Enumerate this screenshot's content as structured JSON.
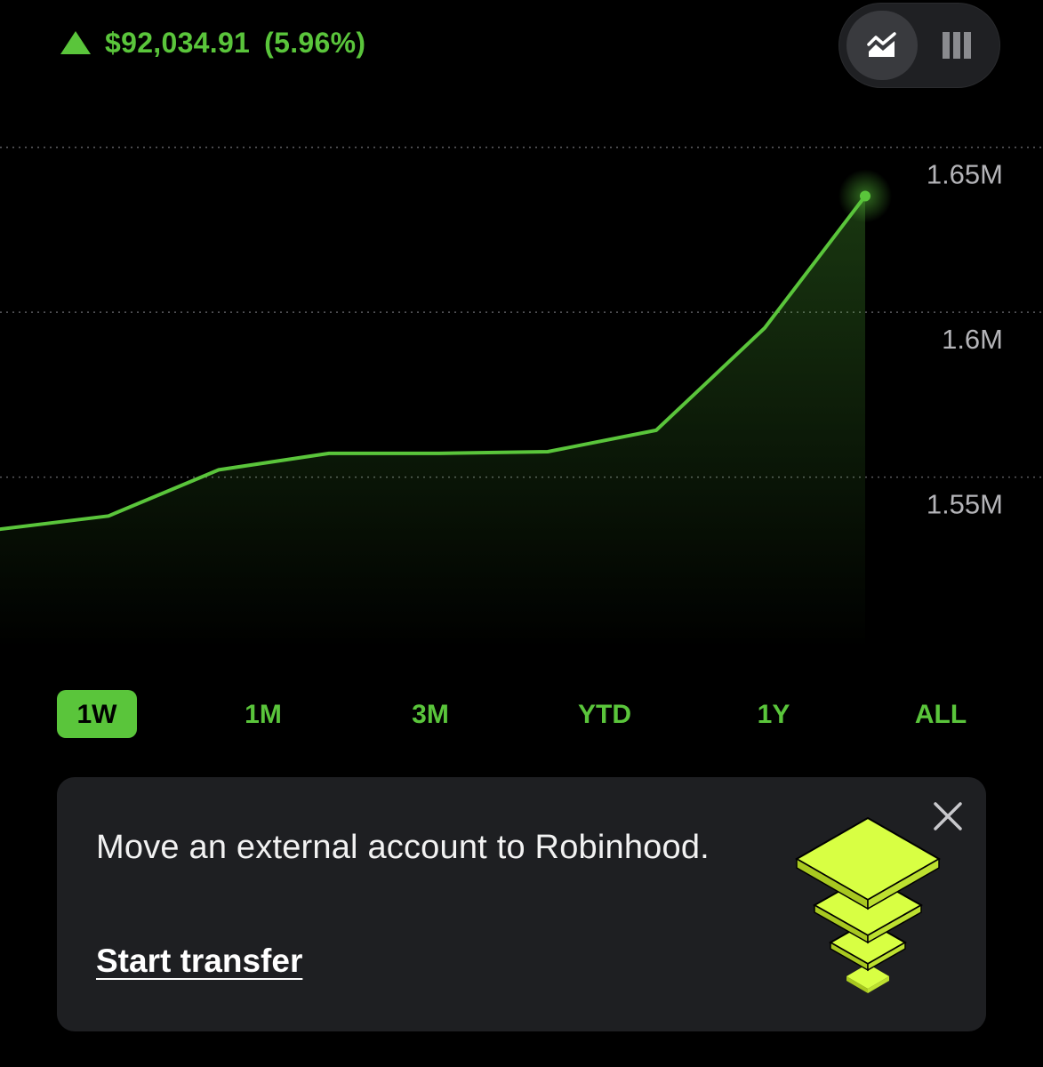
{
  "header": {
    "change_amount": "$92,034.91",
    "change_percent": "(5.96%)",
    "direction": "up",
    "accent_color": "#5ac53b"
  },
  "chart_toggle": {
    "options": [
      {
        "icon": "line-chart-icon",
        "selected": true
      },
      {
        "icon": "bar-chart-icon",
        "selected": false
      }
    ]
  },
  "chart_data": {
    "type": "area",
    "y_tick_labels": [
      "1.65M",
      "1.6M",
      "1.55M"
    ],
    "y_ticks": [
      1650000,
      1600000,
      1550000
    ],
    "ylim": [
      1510000,
      1665000
    ],
    "grid": true,
    "values": [
      1545000,
      1549000,
      1563000,
      1568000,
      1568000,
      1568500,
      1575000,
      1606000,
      1646000
    ],
    "line_color": "#5ac53b",
    "current_point_marker": true
  },
  "ranges": {
    "items": [
      "1W",
      "1M",
      "3M",
      "YTD",
      "1Y",
      "ALL"
    ],
    "selected": "1W"
  },
  "promo_card": {
    "message": "Move an external account to Robinhood.",
    "cta_label": "Start transfer",
    "illustration": "stacked-layers-illustration",
    "close_icon": "close-icon"
  }
}
